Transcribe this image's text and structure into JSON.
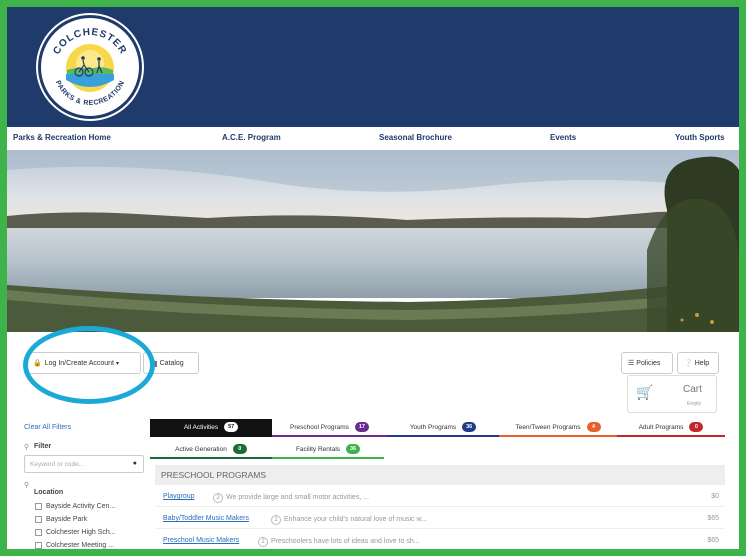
{
  "logo": {
    "top_text": "COLCHESTER",
    "bottom_text": "PARKS & RECREATION"
  },
  "nav": {
    "items": [
      {
        "label": "Parks & Recreation Home"
      },
      {
        "label": "A.C.E. Program"
      },
      {
        "label": "Seasonal Brochure"
      },
      {
        "label": "Events"
      },
      {
        "label": "Youth Sports"
      }
    ]
  },
  "toolbar": {
    "login_label": "Log In/Create Account",
    "catalog_label": "Catalog",
    "policies_label": "Policies",
    "help_label": "Help"
  },
  "cart": {
    "label": "Cart",
    "status": "Empty"
  },
  "sidebar": {
    "clear_filters": "Clear All Filters",
    "filter_heading": "Filter",
    "search_placeholder": "Keyword or code...",
    "location_heading": "Location",
    "locations": [
      {
        "label": "Bayside Activity Cen..."
      },
      {
        "label": "Bayside Park"
      },
      {
        "label": "Colchester High Sch..."
      },
      {
        "label": "Colchester Meeting ..."
      }
    ]
  },
  "tabs": {
    "row1": [
      {
        "label": "All Activities",
        "count": "57",
        "color": "#111111"
      },
      {
        "label": "Preschool Programs",
        "count": "17",
        "color": "#6a2c91"
      },
      {
        "label": "Youth Programs",
        "count": "36",
        "color": "#1f3b8a"
      },
      {
        "label": "Teen/Tween Programs",
        "count": "4",
        "color": "#e8612c"
      },
      {
        "label": "Adult Programs",
        "count": "0",
        "color": "#c0282d"
      }
    ],
    "row2": [
      {
        "label": "Active Generation",
        "count": "0",
        "color": "#1e6b3a"
      },
      {
        "label": "Facility Rentals",
        "count": "36",
        "color": "#3db34a"
      }
    ]
  },
  "list": {
    "section_title": "PRESCHOOL PROGRAMS",
    "rows": [
      {
        "title": "Playgroup",
        "num": "2",
        "desc": "We provide large and small motor activities, ...",
        "price": "$0"
      },
      {
        "title": "Baby/Toddler Music Makers",
        "num": "2",
        "desc": "Enhance your child's natural love of music w...",
        "price": "$65"
      },
      {
        "title": "Preschool Music Makers",
        "num": "2",
        "desc": "Preschoolers have lots of ideas and love to sh...",
        "price": "$65"
      }
    ]
  },
  "colors": {
    "brand_navy": "#1f3b6b",
    "frame_green": "#3db34a",
    "highlight_ring": "#1ba9d8"
  }
}
